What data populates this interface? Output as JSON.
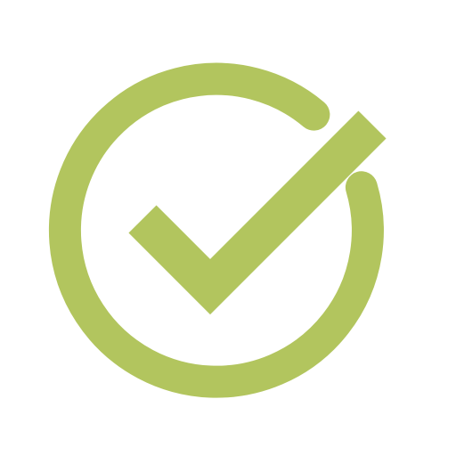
{
  "icon": {
    "name": "check-circle-icon",
    "color": "#b2c55e",
    "background": "#ffffff"
  }
}
